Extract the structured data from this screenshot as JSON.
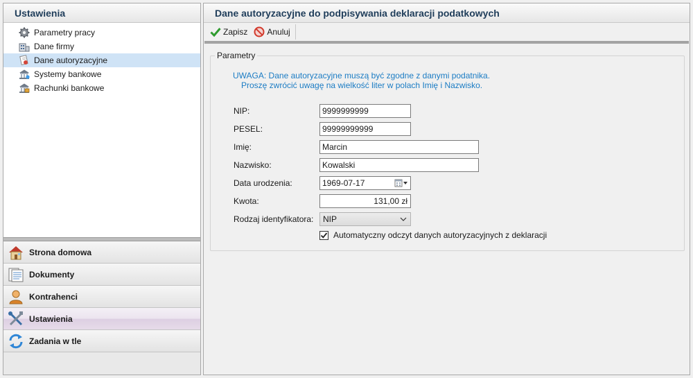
{
  "left_panel": {
    "title": "Ustawienia",
    "tree": [
      {
        "label": "Parametry pracy",
        "icon": "gear-icon",
        "selected": false
      },
      {
        "label": "Dane firmy",
        "icon": "company-icon",
        "selected": false
      },
      {
        "label": "Dane autoryzacyjne",
        "icon": "authorization-icon",
        "selected": true
      },
      {
        "label": "Systemy bankowe",
        "icon": "bank-systems-icon",
        "selected": false
      },
      {
        "label": "Rachunki bankowe",
        "icon": "bank-accounts-icon",
        "selected": false
      }
    ],
    "nav": [
      {
        "label": "Strona domowa",
        "icon": "home-icon",
        "active": false
      },
      {
        "label": "Dokumenty",
        "icon": "documents-icon",
        "active": false
      },
      {
        "label": "Kontrahenci",
        "icon": "contractor-icon",
        "active": false
      },
      {
        "label": "Ustawienia",
        "icon": "tools-icon",
        "active": true
      },
      {
        "label": "Zadania w tle",
        "icon": "refresh-icon",
        "active": false
      }
    ]
  },
  "right_panel": {
    "title": "Dane autoryzacyjne do podpisywania deklaracji podatkowych",
    "toolbar": {
      "save_label": "Zapisz",
      "cancel_label": "Anuluj"
    },
    "group_title": "Parametry",
    "warning_line1": "UWAGA: Dane autoryzacyjne muszą być zgodne z danymi podatnika.",
    "warning_line2": "Proszę zwrócić uwagę na wielkość liter w polach Imię i Nazwisko.",
    "form": {
      "nip_label": "NIP:",
      "nip_value": "9999999999",
      "pesel_label": "PESEL:",
      "pesel_value": "99999999999",
      "first_name_label": "Imię:",
      "first_name_value": "Marcin",
      "last_name_label": "Nazwisko:",
      "last_name_value": "Kowalski",
      "birth_date_label": "Data urodzenia:",
      "birth_date_value": "1969-07-17",
      "amount_label": "Kwota:",
      "amount_value": "131,00 zł",
      "id_type_label": "Rodzaj identyfikatora:",
      "id_type_value": "NIP",
      "auto_read_label": "Automatyczny odczyt danych autoryzacyjnych z deklaracji",
      "auto_read_checked": true
    }
  },
  "colors": {
    "header_text": "#1f3d5a",
    "warning_text": "#1b7cc4",
    "selected_tree_item": "#cfe3f6",
    "active_nav_item": "#e6dbe9"
  }
}
